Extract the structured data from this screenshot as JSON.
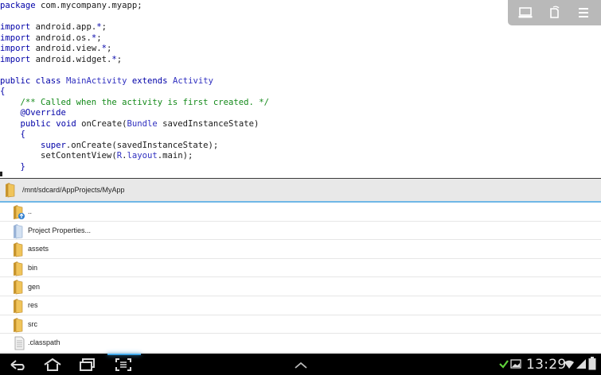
{
  "editor": {
    "lines": [
      [
        {
          "t": "package",
          "c": "kw"
        },
        {
          "t": " com.mycompany.myapp;",
          "c": "pl"
        }
      ],
      [],
      [
        {
          "t": "import",
          "c": "kw"
        },
        {
          "t": " android.app.",
          "c": "pl"
        },
        {
          "t": "*",
          "c": "kw"
        },
        {
          "t": ";",
          "c": "pl"
        }
      ],
      [
        {
          "t": "import",
          "c": "kw"
        },
        {
          "t": " android.os.",
          "c": "pl"
        },
        {
          "t": "*",
          "c": "kw"
        },
        {
          "t": ";",
          "c": "pl"
        }
      ],
      [
        {
          "t": "import",
          "c": "kw"
        },
        {
          "t": " android.view.",
          "c": "pl"
        },
        {
          "t": "*",
          "c": "kw"
        },
        {
          "t": ";",
          "c": "pl"
        }
      ],
      [
        {
          "t": "import",
          "c": "kw"
        },
        {
          "t": " android.widget.",
          "c": "pl"
        },
        {
          "t": "*",
          "c": "kw"
        },
        {
          "t": ";",
          "c": "pl"
        }
      ],
      [],
      [
        {
          "t": "public",
          "c": "kw"
        },
        {
          "t": " ",
          "c": "pl"
        },
        {
          "t": "class",
          "c": "kw"
        },
        {
          "t": " ",
          "c": "pl"
        },
        {
          "t": "MainActivity",
          "c": "ty"
        },
        {
          "t": " ",
          "c": "pl"
        },
        {
          "t": "extends",
          "c": "kw"
        },
        {
          "t": " ",
          "c": "pl"
        },
        {
          "t": "Activity",
          "c": "ty"
        }
      ],
      [
        {
          "t": "{",
          "c": "kw"
        }
      ],
      [
        {
          "t": "    ",
          "c": "pl"
        },
        {
          "t": "/** Called when the activity is first created. */",
          "c": "cm"
        }
      ],
      [
        {
          "t": "    ",
          "c": "pl"
        },
        {
          "t": "@Override",
          "c": "an"
        }
      ],
      [
        {
          "t": "    ",
          "c": "pl"
        },
        {
          "t": "public",
          "c": "kw"
        },
        {
          "t": " ",
          "c": "pl"
        },
        {
          "t": "void",
          "c": "kw"
        },
        {
          "t": " onCreate(",
          "c": "pl"
        },
        {
          "t": "Bundle",
          "c": "ty"
        },
        {
          "t": " savedInstanceState)",
          "c": "pl"
        }
      ],
      [
        {
          "t": "    ",
          "c": "pl"
        },
        {
          "t": "{",
          "c": "kw"
        }
      ],
      [
        {
          "t": "        ",
          "c": "pl"
        },
        {
          "t": "super",
          "c": "kw"
        },
        {
          "t": ".onCreate(savedInstanceState);",
          "c": "pl"
        }
      ],
      [
        {
          "t": "        setContentView(",
          "c": "pl"
        },
        {
          "t": "R",
          "c": "ty"
        },
        {
          "t": ".",
          "c": "pl"
        },
        {
          "t": "layout",
          "c": "ty"
        },
        {
          "t": ".main);",
          "c": "pl"
        }
      ],
      [
        {
          "t": "    ",
          "c": "pl"
        },
        {
          "t": "}",
          "c": "kw"
        }
      ]
    ]
  },
  "toolbar": {
    "buttons": [
      {
        "icon": "keyboard-icon"
      },
      {
        "icon": "rotate-icon"
      },
      {
        "icon": "menu-icon"
      }
    ]
  },
  "browser": {
    "path": "/mnt/sdcard/AppProjects/MyApp",
    "files": [
      {
        "name": "..",
        "icon": "folder-up-icon"
      },
      {
        "name": "Project Properties...",
        "icon": "project-properties-icon"
      },
      {
        "name": "assets",
        "icon": "folder-icon"
      },
      {
        "name": "bin",
        "icon": "folder-icon"
      },
      {
        "name": "gen",
        "icon": "folder-icon"
      },
      {
        "name": "res",
        "icon": "folder-icon"
      },
      {
        "name": "src",
        "icon": "folder-icon"
      },
      {
        "name": ".classpath",
        "icon": "file-icon"
      }
    ]
  },
  "system_bar": {
    "clock": "13:29",
    "nav": [
      "back-icon",
      "home-icon",
      "recent-apps-icon",
      "screenshot-icon"
    ]
  },
  "colors": {
    "keyword": "#0000a8",
    "comment": "#148a1a",
    "accent": "#6fb7e6",
    "folder": "#e0b24a"
  }
}
